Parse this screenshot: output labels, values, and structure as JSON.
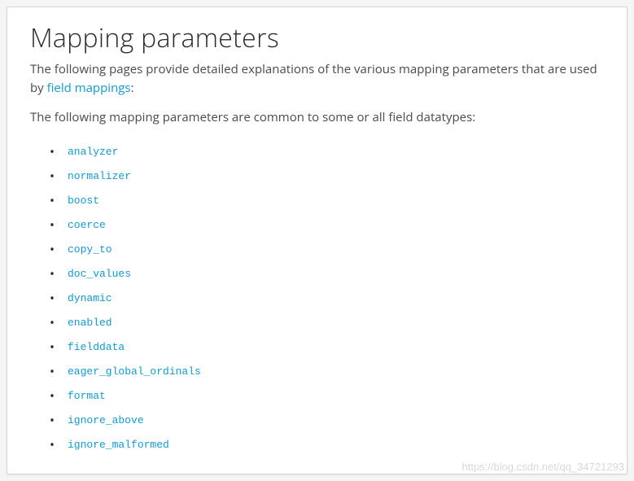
{
  "heading": "Mapping parameters",
  "intro_before": "The following pages provide detailed explanations of the various mapping parameters that are used by ",
  "intro_link": "field mappings",
  "intro_after": ":",
  "subtext": "The following mapping parameters are common to some or all field datatypes:",
  "params": [
    "analyzer",
    "normalizer",
    "boost",
    "coerce",
    "copy_to",
    "doc_values",
    "dynamic",
    "enabled",
    "fielddata",
    "eager_global_ordinals",
    "format",
    "ignore_above",
    "ignore_malformed"
  ],
  "watermark": "https://blog.csdn.net/qq_34721293"
}
